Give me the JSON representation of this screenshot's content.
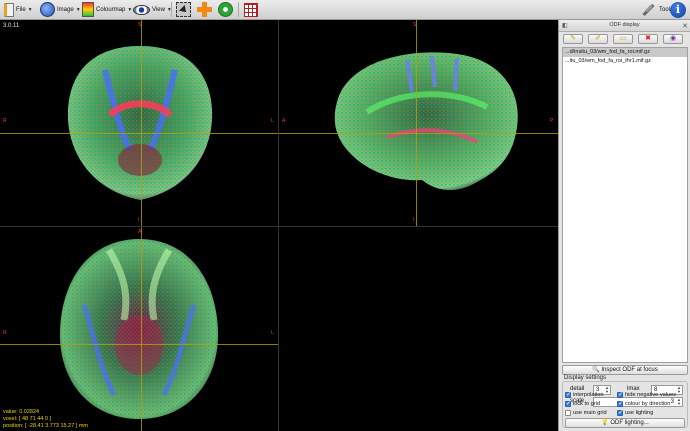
{
  "toolbar": {
    "file_label": "File",
    "image_label": "Image",
    "colourmap_label": "Colourmap",
    "view_label": "View",
    "tool_label": "Tool",
    "icons": [
      "file-icon",
      "image-icon",
      "colourmap-icon",
      "view-icon",
      "select-icon",
      "move-icon",
      "rotate-icon",
      "grid-icon",
      "tool-icon",
      "info-icon"
    ]
  },
  "viewer": {
    "version": "3.0.11",
    "orientation": {
      "top": "S",
      "bottom": "I",
      "left": "R",
      "right": "L",
      "sagittal_top": "S",
      "sagittal_bottom": "I",
      "sagittal_left": "A",
      "sagittal_right": "P",
      "axial_top": "A",
      "axial_bottom": "P",
      "axial_left": "R",
      "axial_right": "L"
    },
    "readout": {
      "value": "value: 0.02824",
      "voxel": "voxel: [ 48 71 44 0 ]",
      "position": "position: [ -28.41 3.773 15.27 ] mm"
    },
    "colors": {
      "crosshair": "#b3a300",
      "orientation": "#ff3030",
      "readout": "#f0d200"
    }
  },
  "panel": {
    "title": "ODF display",
    "close_glyph": "✕",
    "dock_glyph": "◧",
    "tool_glyphs": {
      "open": "✎",
      "save": "✐",
      "clear": "▭",
      "close": "✖",
      "hide": "◉"
    },
    "files": [
      "...d/insitu_03/wm_fod_fa_roi.mif.gz",
      "...itu_03/wm_fod_fa_roi_thr1.mif.gz"
    ],
    "selected_index": 0,
    "inspect_label": "Inspect ODF at focus",
    "display_settings_label": "Display settings",
    "detail_label": "detail",
    "detail_value": "3",
    "lmax_label": "lmax",
    "lmax_value": "8",
    "scale_label": "scale",
    "scale_value": "3",
    "checks": {
      "interpolation": {
        "label": "interpolation",
        "checked": true
      },
      "hide_negative": {
        "label": "hide negative values",
        "checked": true
      },
      "lock_to_grid": {
        "label": "lock to grid",
        "checked": true
      },
      "colour_by_direction": {
        "label": "colour by direction",
        "checked": true
      },
      "use_main_grid": {
        "label": "use main grid",
        "checked": false
      },
      "use_lighting": {
        "label": "use lighting",
        "checked": true
      }
    },
    "lighting_label": "ODF lighting...",
    "check_glyph": "✓"
  }
}
